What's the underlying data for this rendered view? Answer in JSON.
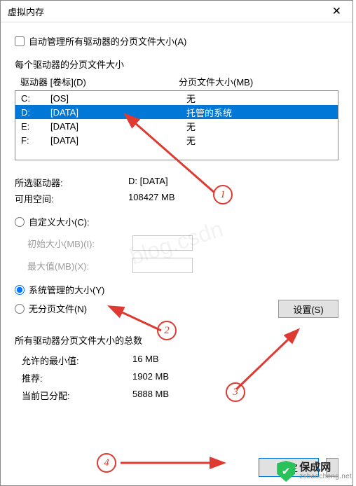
{
  "window": {
    "title": "虚拟内存"
  },
  "auto_manage": {
    "label": "自动管理所有驱动器的分页文件大小(A)",
    "checked": false
  },
  "drives_heading": "每个驱动器的分页文件大小",
  "columns": {
    "drive": "驱动器 [卷标](D)",
    "paging": "分页文件大小(MB)"
  },
  "drives": [
    {
      "letter": "C:",
      "label": "[OS]",
      "paging": "无",
      "selected": false
    },
    {
      "letter": "D:",
      "label": "[DATA]",
      "paging": "托管的系统",
      "selected": true
    },
    {
      "letter": "E:",
      "label": "[DATA]",
      "paging": "无",
      "selected": false
    },
    {
      "letter": "F:",
      "label": "[DATA]",
      "paging": "无",
      "selected": false
    }
  ],
  "selected_drive": {
    "label": "所选驱动器:",
    "value": "D:  [DATA]"
  },
  "free_space": {
    "label": "可用空间:",
    "value": "108427 MB"
  },
  "size_opts": {
    "custom": "自定义大小(C):",
    "initial": "初始大小(MB)(I):",
    "max": "最大值(MB)(X):",
    "system": "系统管理的大小(Y)",
    "none": "无分页文件(N)",
    "selected": "system"
  },
  "set_button": "设置(S)",
  "totals_heading": "所有驱动器分页文件大小的总数",
  "totals": {
    "min": {
      "label": "允许的最小值:",
      "value": "16 MB"
    },
    "rec": {
      "label": "推荐:",
      "value": "1902 MB"
    },
    "cur": {
      "label": "当前已分配:",
      "value": "5888 MB"
    }
  },
  "ok_button": "确定",
  "annotations": {
    "n1": "1",
    "n2": "2",
    "n3": "3",
    "n4": "4"
  },
  "watermark": {
    "name": "保成网",
    "url": "zsbaocheng.net",
    "bg": "blog.csdn"
  },
  "colors": {
    "selection": "#0078d7",
    "annotation": "#de3a31"
  }
}
